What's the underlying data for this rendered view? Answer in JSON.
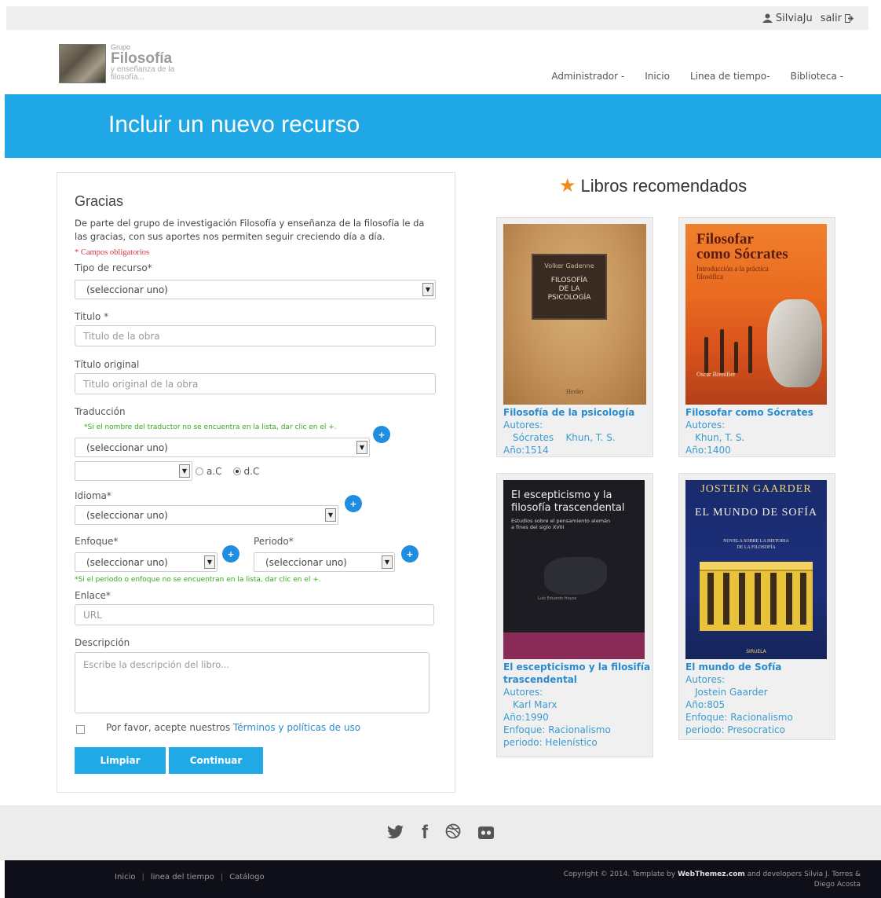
{
  "topbar": {
    "user": "SilviaJu",
    "logout": "salir"
  },
  "logo": {
    "small": "Grupo",
    "big": "Filosofía",
    "sub1": "y enseñanza de la",
    "sub2": "filosofía..."
  },
  "nav": [
    {
      "label": "Administrador -"
    },
    {
      "label": "Inicio"
    },
    {
      "label": "Linea de tiempo-"
    },
    {
      "label": "Biblioteca -"
    }
  ],
  "banner": {
    "title": "Incluir un nuevo recurso"
  },
  "form": {
    "heading": "Gracias",
    "intro": "De parte del grupo de investigación Filosofía y enseñanza de la filosofía le da las gracias, con sus aportes nos permiten seguir creciendo día a día.",
    "required_note": "* Campos obligatorios",
    "tipo_label": "Tipo de recurso*",
    "tipo_value": "(seleccionar uno)",
    "titulo_label": "Titulo *",
    "titulo_placeholder": "Titulo de la obra",
    "titulo_original_label": "Título original",
    "titulo_original_placeholder": "Titulo original de la obra",
    "traduccion_label": "Traducción",
    "traduccion_note": "*Si el nombre del traductor no se encuentra en la lista, dar clic en el +.",
    "traduccion_value": "(seleccionar uno)",
    "radio_ac": "a.C",
    "radio_dc": "d.C",
    "idioma_label": "Idioma*",
    "idioma_value": "(seleccionar uno)",
    "enfoque_label": "Enfoque*",
    "enfoque_value": "(seleccionar uno)",
    "periodo_label": "Periodo*",
    "periodo_value": "(seleccionar uno)",
    "periodo_note": "*Si el periodo o enfoque no se encuentran en la lista, dar clic en el +.",
    "enlace_label": "Enlace*",
    "enlace_placeholder": "URL",
    "descripcion_label": "Descripción",
    "descripcion_placeholder": "Escribe la descripción del libro...",
    "terms_text": "Por favor, acepte nuestros",
    "terms_link": "Términos y políticas de uso",
    "btn_clear": "Limpiar",
    "btn_continue": "Continuar"
  },
  "recommended": {
    "title": "Libros recomendados",
    "books": [
      {
        "title": "Filosofía de la psicología",
        "authors_label": "Autores:",
        "authors": "Sócrates    Khun, T. S.",
        "year": "Año:1514",
        "cover_author": "Volker Gadenne",
        "cover_title1": "FILOSOFÍA",
        "cover_title2": "DE LA",
        "cover_title3": "PSICOLOGÍA",
        "cover_pub": "Herder"
      },
      {
        "title": "Filosofar como Sócrates",
        "authors_label": "Autores:",
        "authors": "Khun, T. S.",
        "year": "Año:1400",
        "cover_title1": "Filosofar",
        "cover_title2": "como Sócrates",
        "cover_sub1": "Introducción a la práctica",
        "cover_sub2": "filosófica",
        "cover_author": "Oscar Brenifier"
      },
      {
        "title1": "El escepticismo y la filosifía",
        "title2": "trascendental",
        "authors_label": "Autores:",
        "authors": "Karl Marx",
        "year": "Año:1990",
        "enfoque": "Enfoque: Racionalismo",
        "periodo": "periodo: Helenístico",
        "cover_title1": "El escepticismo y la",
        "cover_title2": "filosofía trascendental",
        "cover_sub1": "Estudios sobre el pensamiento alemán",
        "cover_sub2": "a fines del siglo XVIII",
        "cover_author": "Luis Eduardo Hoyos"
      },
      {
        "title": "El mundo de Sofía",
        "authors_label": "Autores:",
        "authors": "Jostein Gaarder",
        "year": "Año:805",
        "enfoque": "Enfoque: Racionalismo",
        "periodo": "periodo: Presocratico",
        "cover_author": "JOSTEIN GAARDER",
        "cover_title": "EL MUNDO DE SOFÍA",
        "cover_sub1": "NOVELA SOBRE LA HISTORIA",
        "cover_sub2": "DE LA FILOSOFÍA",
        "cover_pub": "SIRUELA"
      }
    ]
  },
  "footer": {
    "social": [
      "twitter-icon",
      "facebook-icon",
      "dribbble-icon",
      "flickr-icon"
    ],
    "links": [
      "Inicio",
      "linea del tiempo",
      "Catálogo"
    ],
    "copyright1": "Copyright © 2014. Template by",
    "brand": "WebThemez.com",
    "copyright2": "and developers Silvia J. Torres &",
    "copyright3": "Diego Acosta"
  }
}
